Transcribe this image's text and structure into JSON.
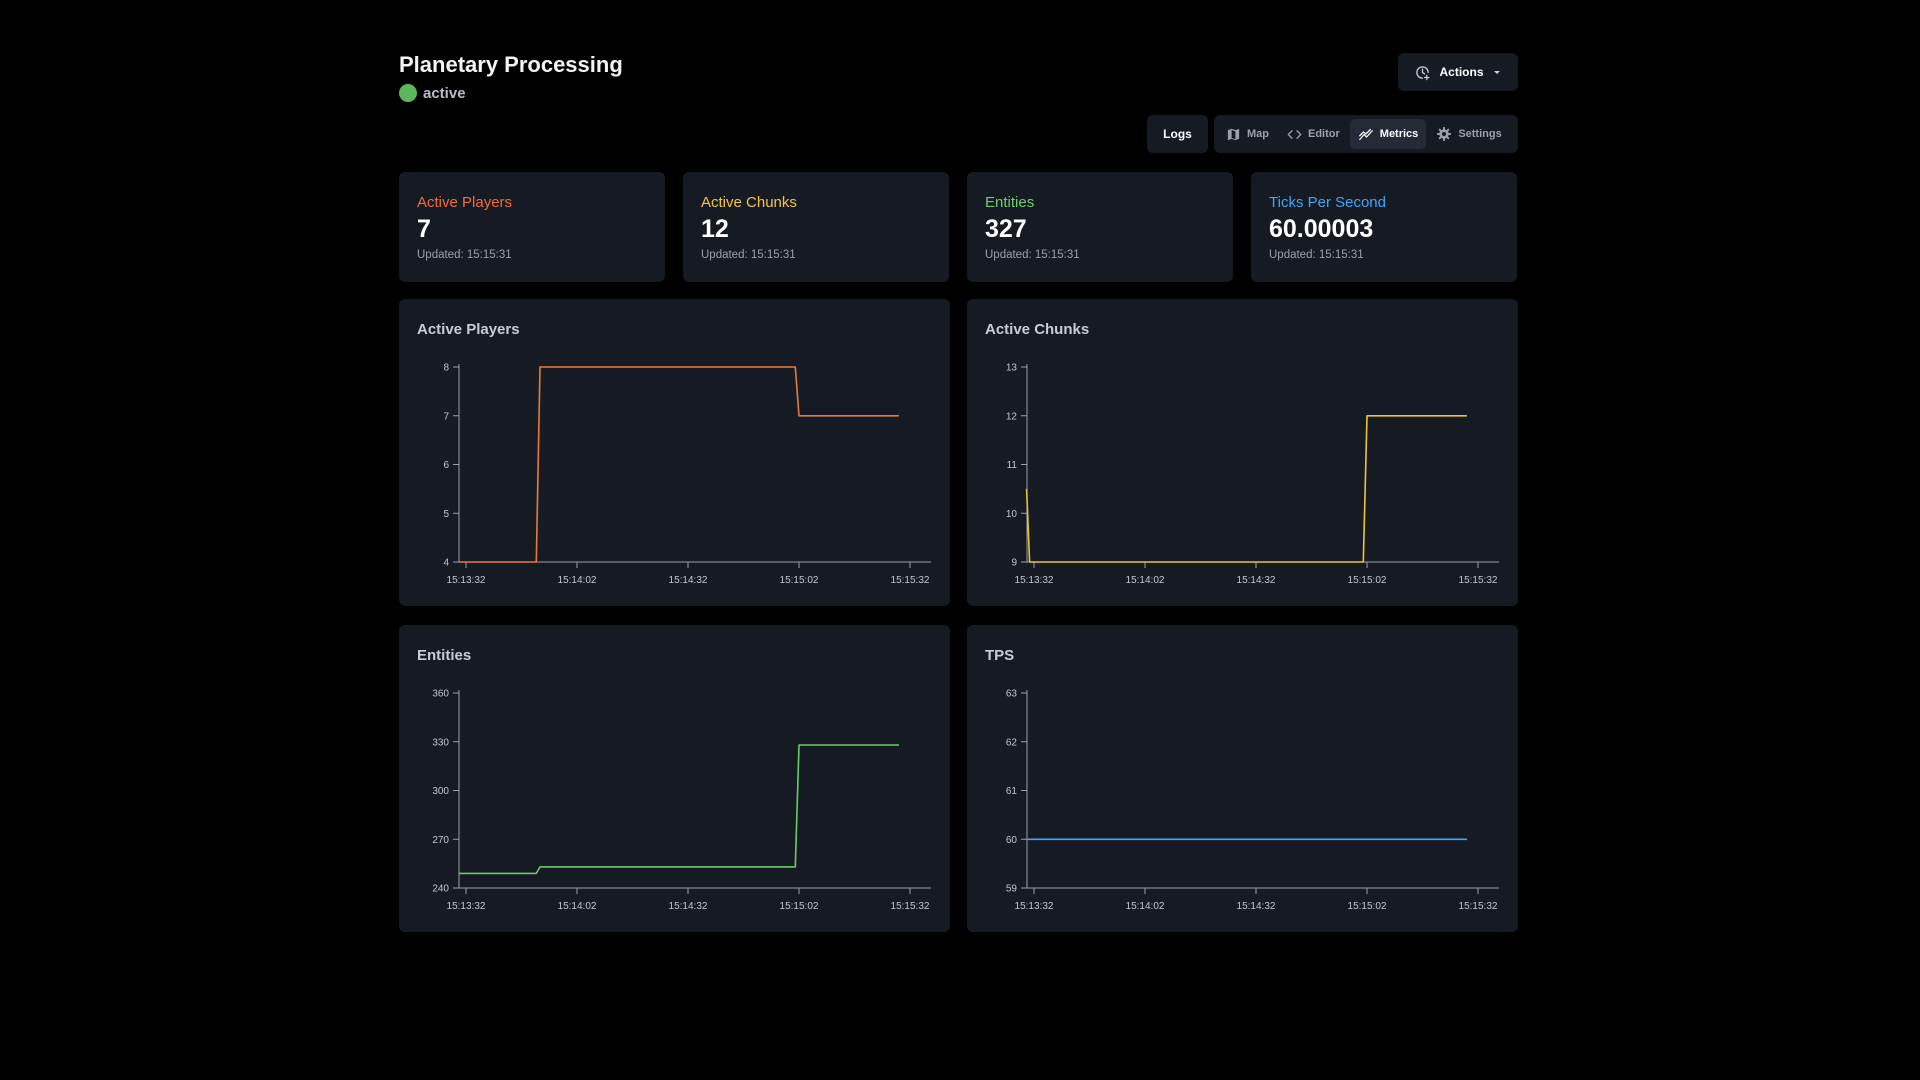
{
  "header": {
    "title": "Planetary Processing",
    "status": "active",
    "status_color": "#5cb85c"
  },
  "actions": {
    "label": "Actions",
    "icon": "project-clock-icon"
  },
  "nav": {
    "logs_label": "Logs",
    "tabs": [
      {
        "label": "Map",
        "icon": "map-icon",
        "active": false
      },
      {
        "label": "Editor",
        "icon": "code-icon",
        "active": false
      },
      {
        "label": "Metrics",
        "icon": "chart-line-icon",
        "active": true
      },
      {
        "label": "Settings",
        "icon": "gear-icon",
        "active": false
      }
    ]
  },
  "stats": [
    {
      "title": "Active Players",
      "value": "7",
      "updated": "Updated: 15:15:31",
      "color": "#f26d3d"
    },
    {
      "title": "Active Chunks",
      "value": "12",
      "updated": "Updated: 15:15:31",
      "color": "#f5c542"
    },
    {
      "title": "Entities",
      "value": "327",
      "updated": "Updated: 15:15:31",
      "color": "#6fcf6f"
    },
    {
      "title": "Ticks Per Second",
      "value": "60.00003",
      "updated": "Updated: 15:15:31",
      "color": "#3ea8f5"
    }
  ],
  "charts": [
    {
      "title": "Active Players",
      "color": "#e8793a"
    },
    {
      "title": "Active Chunks",
      "color": "#f0c23c"
    },
    {
      "title": "Entities",
      "color": "#6ccb6c"
    },
    {
      "title": "TPS",
      "color": "#3ea8f5"
    }
  ],
  "chart_data": [
    {
      "type": "line",
      "title": "Active Players",
      "xlabel": "",
      "ylabel": "",
      "x_ticks": [
        "15:13:32",
        "15:14:02",
        "15:14:32",
        "15:15:02",
        "15:15:32"
      ],
      "y_ticks": [
        4,
        5,
        6,
        7,
        8
      ],
      "ylim": [
        4,
        8
      ],
      "x_range_seconds": [
        0,
        120
      ],
      "series": [
        {
          "color": "#e8793a",
          "points": [
            [
              -2,
              4
            ],
            [
              19,
              4
            ],
            [
              20,
              8
            ],
            [
              89,
              8
            ],
            [
              90,
              7
            ],
            [
              117,
              7
            ]
          ]
        }
      ]
    },
    {
      "type": "line",
      "title": "Active Chunks",
      "xlabel": "",
      "ylabel": "",
      "x_ticks": [
        "15:13:32",
        "15:14:02",
        "15:14:32",
        "15:15:02",
        "15:15:32"
      ],
      "y_ticks": [
        9,
        10,
        11,
        12,
        13
      ],
      "ylim": [
        9,
        13
      ],
      "x_range_seconds": [
        0,
        120
      ],
      "series": [
        {
          "color": "#f0c23c",
          "points": [
            [
              -2,
              10.5
            ],
            [
              -1.2,
              9
            ],
            [
              89,
              9
            ],
            [
              90,
              12
            ],
            [
              117,
              12
            ]
          ]
        }
      ]
    },
    {
      "type": "line",
      "title": "Entities",
      "xlabel": "",
      "ylabel": "",
      "x_ticks": [
        "15:13:32",
        "15:14:02",
        "15:14:32",
        "15:15:02",
        "15:15:32"
      ],
      "y_ticks": [
        240,
        270,
        300,
        330,
        360
      ],
      "ylim": [
        240,
        360
      ],
      "x_range_seconds": [
        0,
        120
      ],
      "series": [
        {
          "color": "#6ccb6c",
          "points": [
            [
              -2,
              249
            ],
            [
              19,
              249
            ],
            [
              20,
              253
            ],
            [
              89,
              253
            ],
            [
              90,
              328
            ],
            [
              117,
              328
            ]
          ]
        }
      ]
    },
    {
      "type": "line",
      "title": "TPS",
      "xlabel": "",
      "ylabel": "",
      "x_ticks": [
        "15:13:32",
        "15:14:02",
        "15:14:32",
        "15:15:02",
        "15:15:32"
      ],
      "y_ticks": [
        59,
        60,
        61,
        62,
        63
      ],
      "ylim": [
        59,
        63
      ],
      "x_range_seconds": [
        0,
        120
      ],
      "series": [
        {
          "color": "#3ea8f5",
          "points": [
            [
              -2,
              60
            ],
            [
              117,
              60
            ]
          ]
        }
      ]
    }
  ]
}
